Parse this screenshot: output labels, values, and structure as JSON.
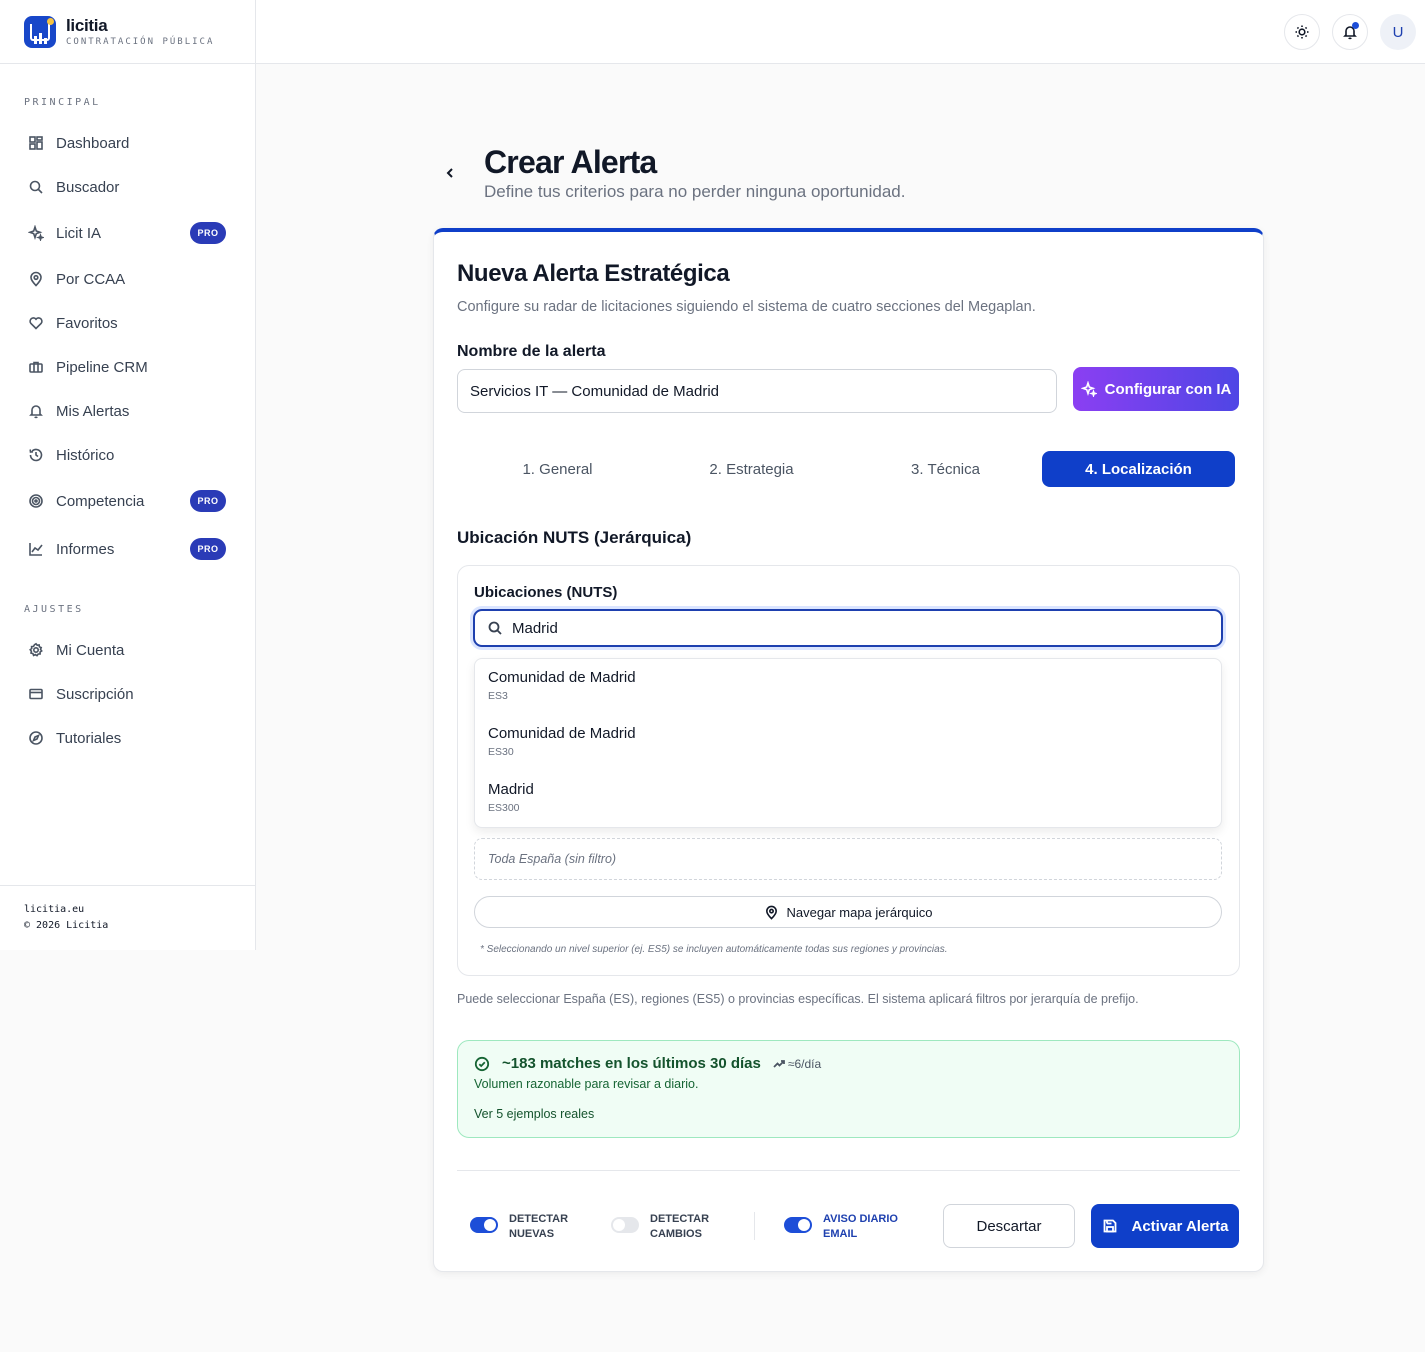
{
  "brand": {
    "name": "licitia",
    "subtitle": "CONTRATACIÓN PÚBLICA"
  },
  "sidebar": {
    "section_principal": "PRINCIPAL",
    "section_ajustes": "AJUSTES",
    "items": [
      {
        "label": "Dashboard",
        "icon": "grid-icon"
      },
      {
        "label": "Buscador",
        "icon": "search-icon"
      },
      {
        "label": "Licit IA",
        "icon": "sparkles-icon",
        "badge": "PRO"
      },
      {
        "label": "Por CCAA",
        "icon": "map-pin-icon"
      },
      {
        "label": "Favoritos",
        "icon": "heart-icon"
      },
      {
        "label": "Pipeline CRM",
        "icon": "briefcase-icon"
      },
      {
        "label": "Mis Alertas",
        "icon": "bell-icon"
      },
      {
        "label": "Histórico",
        "icon": "history-icon"
      },
      {
        "label": "Competencia",
        "icon": "target-icon",
        "badge": "PRO"
      },
      {
        "label": "Informes",
        "icon": "line-chart-icon",
        "badge": "PRO"
      }
    ],
    "settings": [
      {
        "label": "Mi Cuenta",
        "icon": "gear-icon"
      },
      {
        "label": "Suscripción",
        "icon": "credit-card-icon"
      },
      {
        "label": "Tutoriales",
        "icon": "compass-icon"
      }
    ],
    "footer_domain": "licitia.eu",
    "footer_copyright": "© 2026 Licitia"
  },
  "topbar": {
    "avatar_initial": "U"
  },
  "page": {
    "title": "Crear Alerta",
    "subtitle": "Define tus criterios para no perder ninguna oportunidad."
  },
  "card": {
    "title": "Nueva Alerta Estratégica",
    "subtitle": "Configure su radar de licitaciones siguiendo el sistema de cuatro secciones del Megaplan.",
    "name_label": "Nombre de la alerta",
    "name_value": "Servicios IT — Comunidad de Madrid",
    "ai_button": "Configurar con IA",
    "tabs": [
      "1. General",
      "2. Estrategia",
      "3. Técnica",
      "4. Localización"
    ],
    "active_tab": "4. Localización",
    "section_title": "Ubicación NUTS (Jerárquica)",
    "nuts_label": "Ubicaciones (NUTS)",
    "search_value": "Madrid",
    "options": [
      {
        "name": "Comunidad de Madrid",
        "code": "ES3"
      },
      {
        "name": "Comunidad de Madrid",
        "code": "ES30"
      },
      {
        "name": "Madrid",
        "code": "ES300"
      }
    ],
    "empty_selection": "Toda España (sin filtro)",
    "map_button": "Navegar mapa jerárquico",
    "nuts_note": "* Seleccionando un nivel superior (ej. ES5) se incluyen automáticamente todas sus regiones y provincias.",
    "help_text": "Puede seleccionar España (ES), regiones (ES5) o provincias específicas. El sistema aplicará filtros por jerarquía de prefijo.",
    "match_title": "~183 matches en los últimos 30 días",
    "match_rate": "≈6/día",
    "match_sub": "Volumen razonable para revisar a diario.",
    "match_link": "Ver 5 ejemplos reales",
    "toggles": [
      {
        "line1": "DETECTAR",
        "line2": "NUEVAS",
        "on": true
      },
      {
        "line1": "DETECTAR",
        "line2": "CAMBIOS",
        "on": false
      },
      {
        "line1": "AVISO DIARIO",
        "line2": "EMAIL",
        "on": true
      }
    ],
    "discard_button": "Descartar",
    "activate_button": "Activar Alerta"
  },
  "colors": {
    "primary": "#0f3fc9",
    "pro_badge": "#2a3bb7",
    "ai_gradient_start": "#8b3ff2",
    "success_bg": "#f0fdf5"
  }
}
